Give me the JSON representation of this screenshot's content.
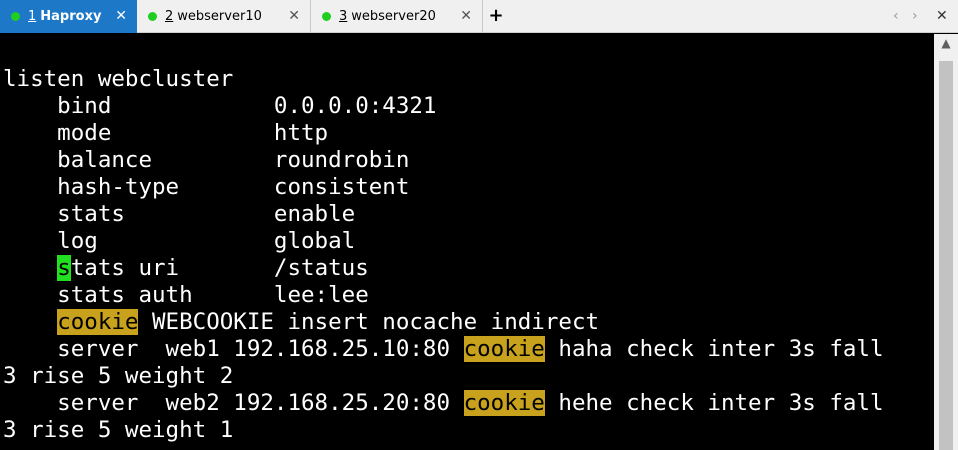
{
  "tabs": [
    {
      "num": "1",
      "label": "Haproxy",
      "close": "✕",
      "status_color": "#1fcf1f"
    },
    {
      "num": "2",
      "label": "webserver10",
      "close": "✕",
      "status_color": "#1fcf1f"
    },
    {
      "num": "3",
      "label": "webserver20",
      "close": "✕",
      "status_color": "#1fcf1f"
    }
  ],
  "tab_add": "+",
  "nav": {
    "prev": "‹",
    "next": "›",
    "close": "✕"
  },
  "scrollbar": {
    "up_arrow": "▲"
  },
  "terminal": {
    "line1": "listen webcluster",
    "line2": "    bind            0.0.0.0:4321",
    "line3": "    mode            http",
    "line4": "    balance         roundrobin",
    "line5": "    hash-type       consistent",
    "line6": "    stats           enable",
    "line7": "    log             global",
    "line8_cursor": "s",
    "line8_rest": "tats uri       /status",
    "line9": "    stats auth      lee:lee",
    "line10_kw": "cookie",
    "line10_rest": " WEBCOOKIE insert nocache indirect",
    "line11_a": "    server  web1 192.168.25.10:80 ",
    "line11_kw": "cookie",
    "line11_b": " haha check inter 3s fall",
    "line12": "3 rise 5 weight 2",
    "line13_a": "    server  web2 192.168.25.20:80 ",
    "line13_kw": "cookie",
    "line13_b": " hehe check inter 3s fall",
    "line14": "3 rise 5 weight 1"
  },
  "colors": {
    "tab_active_bg": "#1d79c7",
    "status_dot": "#1fcf1f",
    "highlight": "#c8a21c",
    "cursor": "#20e020",
    "terminal_bg": "#000000",
    "terminal_fg": "#ffffff"
  }
}
